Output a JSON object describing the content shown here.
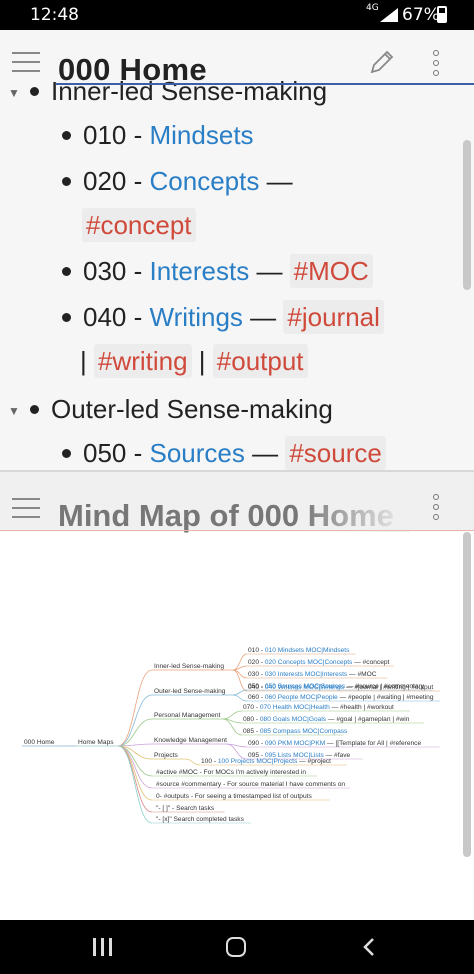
{
  "status": {
    "time": "12:48",
    "network": "4G",
    "battery": "67%"
  },
  "note": {
    "title": "000 Home",
    "rows": [
      {
        "heading": "Inner-led Sense-making"
      },
      {
        "num": "010 - ",
        "link": "Mindsets"
      },
      {
        "num": "020 - ",
        "link": "Concepts",
        "dash": " —",
        "tags": [
          "#concept"
        ]
      },
      {
        "num": "030 - ",
        "link": "Interests",
        "dash": " — ",
        "tags": [
          "#MOC"
        ]
      },
      {
        "num": "040 - ",
        "link": "Writings",
        "dash": " — ",
        "tags": [
          "#journal",
          "#writing",
          "#output"
        ],
        "sep": " | "
      },
      {
        "heading": "Outer-led Sense-making"
      },
      {
        "num": "050 - ",
        "link": "Sources",
        "dash": " — ",
        "tags": [
          "#source"
        ]
      }
    ]
  },
  "mindmap": {
    "title": "Mind Map of 000 Home",
    "root": "000 Home",
    "hub": "Home Maps",
    "branches": [
      {
        "label": "Inner-led Sense-making",
        "leaves": [
          [
            "010 - ",
            "010 Mindsets MOC|Mindsets",
            ""
          ],
          [
            "020 - ",
            "020 Concepts MOC|Concepts",
            " — #concept"
          ],
          [
            "030 - ",
            "030 Interests MOC|Interests",
            " — #MOC"
          ],
          [
            "040 - ",
            "040 Writings MOC|Writings",
            " — #journal | #writing | #output"
          ]
        ]
      },
      {
        "label": "Outer-led Sense-making",
        "leaves": [
          [
            "050 - ",
            "050 Sources MOC|Sources",
            " — #source | #commentary"
          ],
          [
            "060 - ",
            "060 People MOC|People",
            " — #people | #waiting | #meeting"
          ]
        ]
      },
      {
        "label": "Personal Management",
        "leaves": [
          [
            "070 - ",
            "070 Health MOC|Health",
            " — #health | #workout"
          ],
          [
            "080 - ",
            "080 Goals MOC|Goals",
            " — #goal | #gameplan | #win"
          ],
          [
            "085 - ",
            "085 Compass MOC|Compass",
            ""
          ]
        ]
      },
      {
        "label": "Knowledge Management",
        "leaves": [
          [
            "090 - ",
            "090 PKM MOC|PKM",
            " — [[Template for All | #reference"
          ],
          [
            "095 - ",
            "095 Lists MOC|Lists",
            " — #fave"
          ]
        ]
      },
      {
        "label": "Projects",
        "leaves": [
          [
            "100 - ",
            "100 Projects MOC|Projects",
            " — #project"
          ]
        ]
      }
    ],
    "notes": [
      "#active #MOC - For MOCs I'm actively interested in",
      "#source #commentary - For source material I have comments on",
      "0- #outputs - For seeing a timestamped list of outputs",
      "\"- [ ]\" - Search tasks",
      "\"- [x]\" Search completed tasks"
    ]
  },
  "colors": {
    "link": "#2a7ec6",
    "tag": "#d04a3c",
    "accent": "#3b5fa8"
  }
}
